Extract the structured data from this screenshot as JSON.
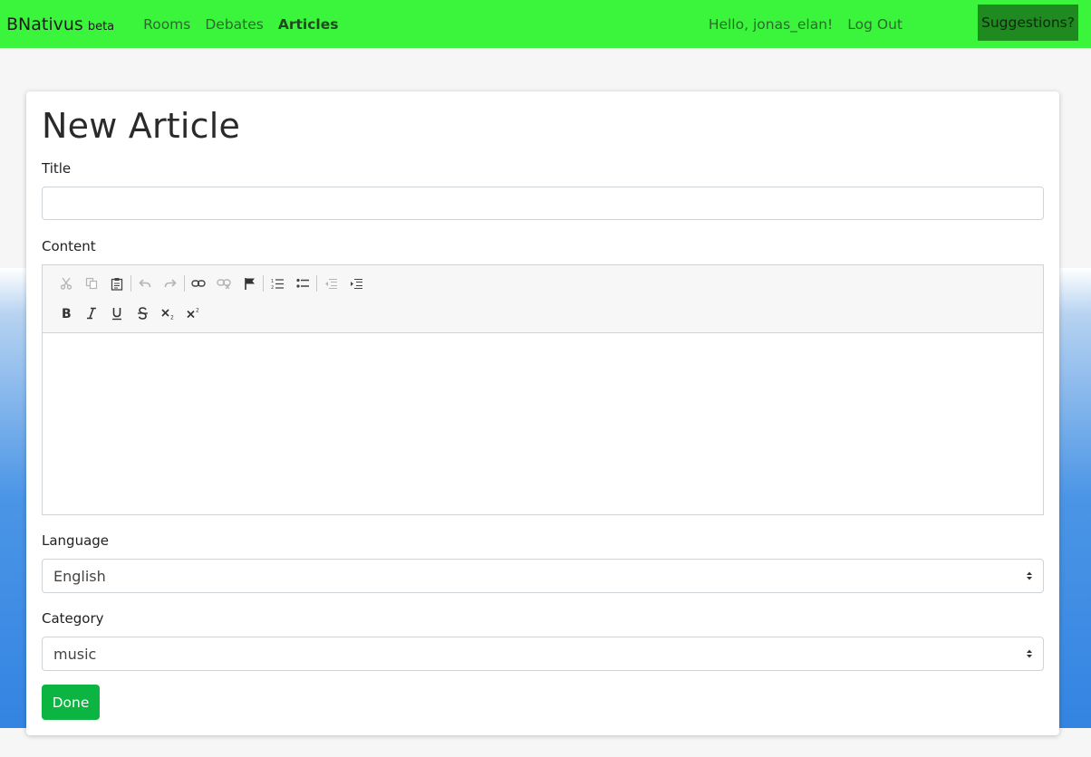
{
  "nav": {
    "brand": "BNativus",
    "brand_tag": "beta",
    "links": [
      "Rooms",
      "Debates",
      "Articles"
    ],
    "active": "Articles",
    "greeting": "Hello, jonas_elan!",
    "logout": "Log Out",
    "suggestions": "Suggestions?"
  },
  "form": {
    "title": "New Article",
    "title_label": "Title",
    "title_value": "",
    "content_label": "Content",
    "language_label": "Language",
    "language_value": "English",
    "category_label": "Category",
    "category_value": "music",
    "submit_label": "Done"
  },
  "toolbar": {
    "row1": [
      "cut-icon",
      "copy-icon",
      "paste-icon",
      "undo-icon",
      "redo-icon",
      "link-icon",
      "unlink-icon",
      "anchor-flag-icon",
      "numbered-list-icon",
      "bulleted-list-icon",
      "outdent-icon",
      "indent-icon"
    ],
    "row2": [
      "bold-icon",
      "italic-icon",
      "underline-icon",
      "strikethrough-icon",
      "subscript-icon",
      "superscript-icon"
    ]
  },
  "colors": {
    "navbar": "#3bf53c",
    "suggestions_bg": "#1e8a1f",
    "done_button": "#0cb441",
    "background_band": "#3384e2"
  }
}
